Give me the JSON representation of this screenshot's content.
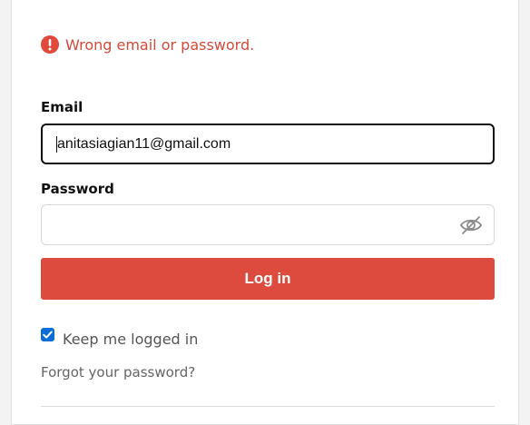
{
  "error": {
    "icon": "exclamation-circle-icon",
    "message": "Wrong email or password.",
    "color": "#d64a3c"
  },
  "email": {
    "label": "Email",
    "value": "anitasiagian11@gmail.com"
  },
  "password": {
    "label": "Password",
    "value": "",
    "toggle_icon": "eye-slash-icon"
  },
  "login_button": {
    "label": "Log in",
    "color": "#dd4b3e"
  },
  "keep_logged_in": {
    "label": "Keep me logged in",
    "checked": true
  },
  "forgot_password": {
    "label": "Forgot your password?"
  }
}
